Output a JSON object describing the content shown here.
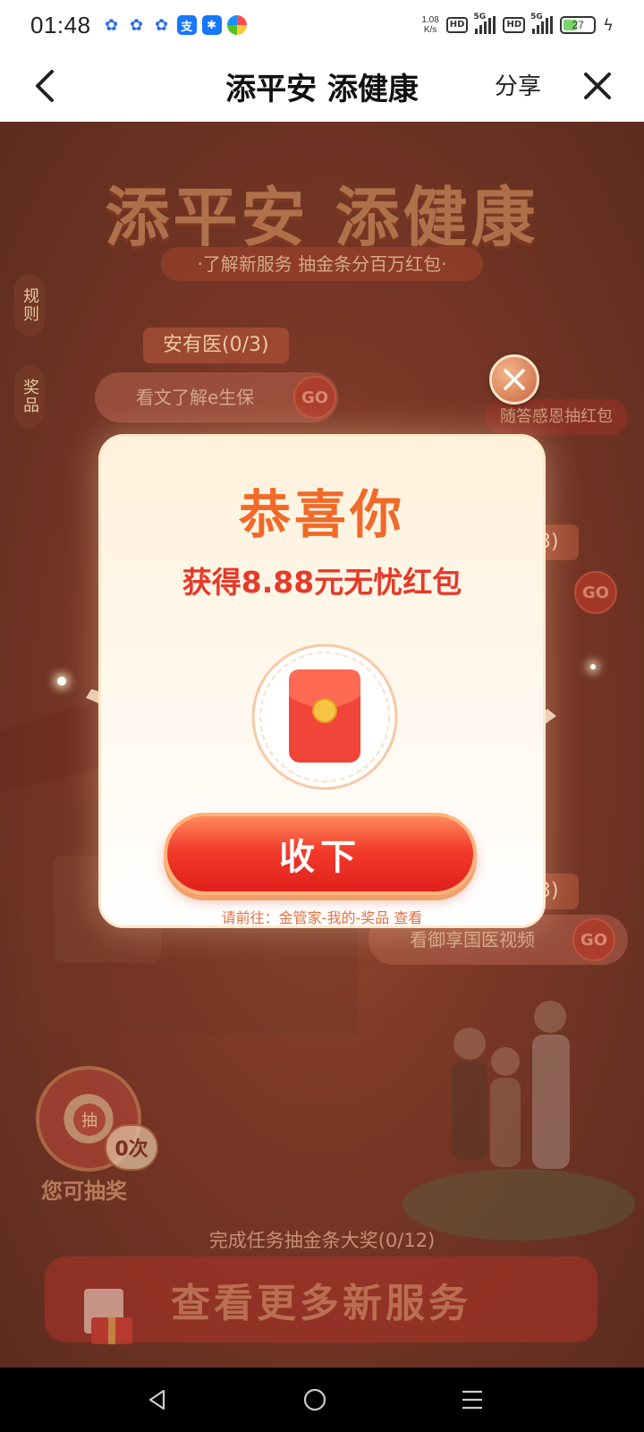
{
  "status_bar": {
    "time": "01:48",
    "net_speed_value": "1.08",
    "net_speed_unit": "K/s",
    "network_label_1": "5G",
    "network_label_2": "5G",
    "hd_label_1": "HD",
    "hd_label_2": "HD",
    "battery": "27"
  },
  "nav": {
    "title": "添平安 添健康",
    "share_label": "分享"
  },
  "background_page": {
    "hero_title": "添平安 添健康",
    "hero_subtitle": "·了解新服务 抽金条分百万红包·",
    "side_tabs": [
      "规则",
      "奖品"
    ],
    "task_1_tag": "安有医(0/3)",
    "task_1_action": "看文了解e生保",
    "go_label": "GO",
    "right_badge": "随答感恩抽红包",
    "task_2_tag_suffix": "3)",
    "task_3_tag_suffix": "3)",
    "task_3_action": "看御享国医视频",
    "wheel_center": "抽",
    "draw_count": "0次",
    "draw_label": "您可抽奖",
    "progress_text": "完成任务抽金条大奖(0/12)",
    "more_services_button": "查看更多新服务"
  },
  "popup": {
    "title": "恭喜你",
    "subtitle": "获得8.88元无忧红包",
    "claim_button": "收下",
    "hint": "请前往：金管家-我的-奖品 查看"
  },
  "colors": {
    "popup_title": "#f06a2a",
    "popup_subtitle": "#e53a2a",
    "claim_button": "#e0201c",
    "page_overlay": "#9b4a36"
  }
}
